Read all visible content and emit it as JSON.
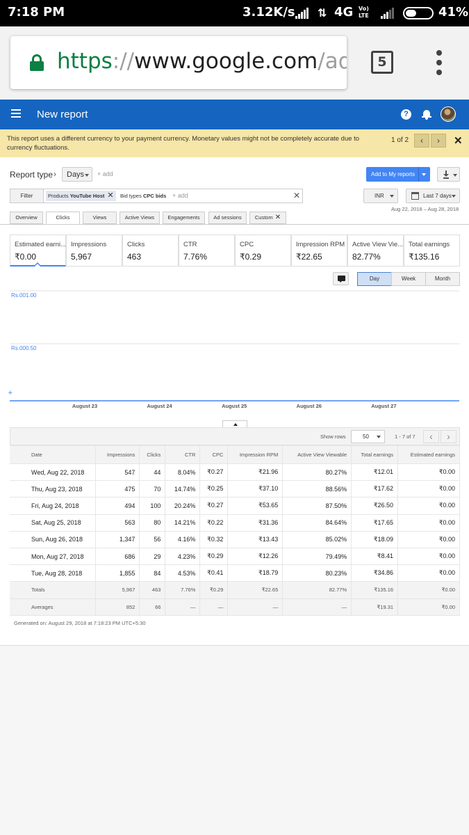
{
  "status_bar": {
    "time": "7:18 PM",
    "speed": "3.12K/s",
    "network": "4G",
    "volte_line1": "Vo)",
    "volte_line2": "LTE",
    "battery": "41%",
    "battery_level": 0.41
  },
  "browser": {
    "url_scheme": "https",
    "url_sep": "://",
    "url_host": "www.google.com",
    "url_path": "/adse",
    "tab_count": "5"
  },
  "appbar": {
    "title": "New report",
    "help_glyph": "?"
  },
  "banner": {
    "message": "This report uses a different currency to your payment currency. Monetary values might not be completely accurate due to currency fluctuations.",
    "pager": "1 of 2",
    "prev": "‹",
    "next": "›",
    "close": "✕"
  },
  "controls": {
    "report_type_label": "Report type",
    "report_type_arrow": "›",
    "days": "Days",
    "add": "+ add",
    "add_to_reports": "Add to My reports",
    "filter_label": "Filter",
    "chip1_key": "Products",
    "chip1_value": "YouTube Host",
    "chip2_key": "Bid types",
    "chip2_value": "CPC bids",
    "chip_close": "✕",
    "filter_add": "+ add",
    "filter_clear": "✕",
    "currency": "INR",
    "range": "Last 7 days",
    "date_range": "Aug 22, 2018 – Aug 28, 2018"
  },
  "tabs": [
    {
      "label": "Overview"
    },
    {
      "label": "Clicks"
    },
    {
      "label": "Views"
    },
    {
      "label": "Active Views"
    },
    {
      "label": "Engagements"
    },
    {
      "label": "Ad sessions"
    },
    {
      "label": "Custom"
    }
  ],
  "tab_close": "✕",
  "scorecards": [
    {
      "title": "Estimated earni...",
      "value": "₹0.00"
    },
    {
      "title": "Impressions",
      "value": "5,967"
    },
    {
      "title": "Clicks",
      "value": "463"
    },
    {
      "title": "CTR",
      "value": "7.76%"
    },
    {
      "title": "CPC",
      "value": "₹0.29"
    },
    {
      "title": "Impression RPM",
      "value": "₹22.65"
    },
    {
      "title": "Active View Vie...",
      "value": "82.77%"
    },
    {
      "title": "Total earnings",
      "value": "₹135.16"
    }
  ],
  "granularity": {
    "day": "Day",
    "week": "Week",
    "month": "Month"
  },
  "chart_data": {
    "type": "line",
    "x": [
      "August 22",
      "August 23",
      "August 24",
      "August 25",
      "August 26",
      "August 27",
      "August 28"
    ],
    "x_tick_labels": [
      "August 23",
      "August 24",
      "August 25",
      "August 26",
      "August 27"
    ],
    "series": [
      {
        "values": [
          0,
          0,
          0,
          0,
          0,
          0,
          0
        ]
      }
    ],
    "y_tick_labels": [
      "Rs.001.00",
      "Rs.000.50"
    ],
    "ylim": [
      0,
      1
    ],
    "grid": true,
    "line_color": "#4285f4",
    "title": "",
    "xlabel": "",
    "ylabel": ""
  },
  "table": {
    "show_rows_label": "Show rows",
    "rows": "50",
    "range": "1 - 7 of 7",
    "prev": "‹",
    "next": "›",
    "columns": [
      "Date",
      "Impressions",
      "Clicks",
      "CTR",
      "CPC",
      "Impression RPM",
      "Active View Viewable",
      "Total earnings",
      "Estimated earnings"
    ],
    "data": [
      [
        "Wed, Aug 22, 2018",
        "547",
        "44",
        "8.04%",
        "₹0.27",
        "₹21.96",
        "80.27%",
        "₹12.01",
        "₹0.00"
      ],
      [
        "Thu, Aug 23, 2018",
        "475",
        "70",
        "14.74%",
        "₹0.25",
        "₹37.10",
        "88.56%",
        "₹17.62",
        "₹0.00"
      ],
      [
        "Fri, Aug 24, 2018",
        "494",
        "100",
        "20.24%",
        "₹0.27",
        "₹53.65",
        "87.50%",
        "₹26.50",
        "₹0.00"
      ],
      [
        "Sat, Aug 25, 2018",
        "563",
        "80",
        "14.21%",
        "₹0.22",
        "₹31.36",
        "84.64%",
        "₹17.65",
        "₹0.00"
      ],
      [
        "Sun, Aug 26, 2018",
        "1,347",
        "56",
        "4.16%",
        "₹0.32",
        "₹13.43",
        "85.02%",
        "₹18.09",
        "₹0.00"
      ],
      [
        "Mon, Aug 27, 2018",
        "686",
        "29",
        "4.23%",
        "₹0.29",
        "₹12.26",
        "79.49%",
        "₹8.41",
        "₹0.00"
      ],
      [
        "Tue, Aug 28, 2018",
        "1,855",
        "84",
        "4.53%",
        "₹0.41",
        "₹18.79",
        "80.23%",
        "₹34.86",
        "₹0.00"
      ]
    ],
    "totals": [
      "Totals",
      "5,967",
      "463",
      "7.76%",
      "₹0.29",
      "₹22.65",
      "82.77%",
      "₹135.16",
      "₹0.00"
    ],
    "averages": [
      "Averages",
      "852",
      "66",
      "—",
      "—",
      "—",
      "—",
      "₹19.31",
      "₹0.00"
    ]
  },
  "generated": "Generated on: August 29, 2018 at 7:18:23 PM UTC+5:30"
}
